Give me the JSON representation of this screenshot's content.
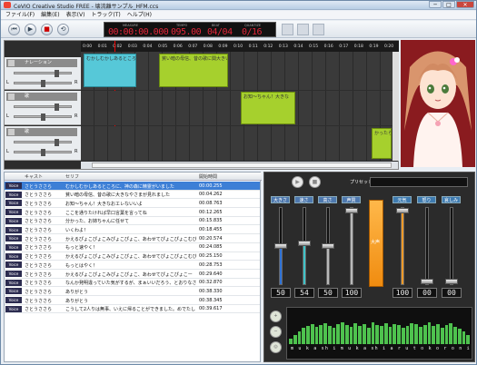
{
  "window": {
    "title": "CeVIO Creative Studio FREE - 壊流離サンプル_HFM.ccs",
    "minimize": "─",
    "maximize": "□",
    "close": "✕"
  },
  "menu": [
    "ファイル(F)",
    "編集(E)",
    "表示(V)",
    "トラック(T)",
    "ヘルプ(H)"
  ],
  "toolbar": {
    "rewind": "⏮",
    "play": "▶",
    "stop": "■",
    "loop": "⟲",
    "lcd": {
      "time_label": "MEASURE",
      "time": "00:00:00.000",
      "tempo_label": "TEMPO",
      "tempo": "095.00",
      "beat_label": "BEAT",
      "beat": "04/04",
      "quantize_label": "QUANTIZE",
      "quantize": "0/16"
    }
  },
  "ruler": [
    "0:00",
    "0:01",
    "0:02",
    "0:03",
    "0:04",
    "0:05",
    "0:06",
    "0:07",
    "0:08",
    "0:09",
    "0:10",
    "0:11",
    "0:12",
    "0:13",
    "0:14",
    "0:15",
    "0:16",
    "0:17",
    "0:18",
    "0:19",
    "0:20"
  ],
  "tracks": [
    {
      "name": "ナレーション",
      "pan_l": "L",
      "pan_r": "R"
    },
    {
      "name": "歌",
      "pan_l": "L",
      "pan_r": "R"
    },
    {
      "name": "歌",
      "pan_l": "L",
      "pan_r": "R"
    }
  ],
  "clips": [
    {
      "text": "むかしむかしあるところに",
      "color": "cyan"
    },
    {
      "text": "貧い暗の母信、昔の歌に関大きい",
      "color": "green"
    },
    {
      "text": "お知〜ちゃん！大きな",
      "color": "green"
    },
    {
      "text": "かったら",
      "color": "green"
    }
  ],
  "table": {
    "headers": {
      "cast": "キャスト",
      "line": "セリフ",
      "time": "開始時間"
    },
    "rows": [
      {
        "voice": "Voice",
        "cast": "さとうささら",
        "line": "むかしむかしあるところに、神の森に精霊がいました",
        "time": "00:00.255",
        "selected": true
      },
      {
        "voice": "Voice",
        "cast": "さとうささら",
        "line": "貧い暗の母信、昔の歌に大きなやさまが見れました",
        "time": "00:04.262",
        "selected": false
      },
      {
        "voice": "Voice",
        "cast": "さとうささら",
        "line": "お知〜ちゃん！大きなおエレないいよ",
        "time": "00:08.763",
        "selected": false
      },
      {
        "voice": "Voice",
        "cast": "さとうささら",
        "line": "ここを通りたければ早口言葉を言ってね",
        "time": "00:12.265",
        "selected": false
      },
      {
        "voice": "Voice",
        "cast": "さとうささら",
        "line": "分かった、お姉ちゃんに任せて",
        "time": "00:15.835",
        "selected": false
      },
      {
        "voice": "Voice",
        "cast": "さとうささら",
        "line": "いくわよ！",
        "time": "00:18.455",
        "selected": false
      },
      {
        "voice": "Voice",
        "cast": "さとうささら",
        "line": "かえるぴょこぴょこみぴょこぴょこ、あわせてぴょこぴょこむぴ",
        "time": "00:20.574",
        "selected": false
      },
      {
        "voice": "Voice",
        "cast": "さとうささら",
        "line": "もっと速やく！",
        "time": "00:24.085",
        "selected": false
      },
      {
        "voice": "Voice",
        "cast": "さとうささら",
        "line": "かえるぴょこぴょこみぴょこぴょこ、あわせてぴょこぴょこむぴ",
        "time": "00:25.150",
        "selected": false
      },
      {
        "voice": "Voice",
        "cast": "さとうささら",
        "line": "もっとはやく！",
        "time": "00:28.753",
        "selected": false
      },
      {
        "voice": "Voice",
        "cast": "さとうささら",
        "line": "かえるぴょこぴょこみぴょこぴょこ、あわせてぴょこぴょこー",
        "time": "00:29.640",
        "selected": false
      },
      {
        "voice": "Voice",
        "cast": "さとうささら",
        "line": "なんか発明違っていた気がするが、まぁいいだろう、とおりなさい",
        "time": "00:32.870",
        "selected": false
      },
      {
        "voice": "Voice",
        "cast": "さとうささら",
        "line": "ありがとう",
        "time": "00:38.330",
        "selected": false
      },
      {
        "voice": "Voice",
        "cast": "さとうささら",
        "line": "ありがとう",
        "time": "00:38.345",
        "selected": false
      },
      {
        "voice": "Voice",
        "cast": "さとうささら",
        "line": "こうして2人りは無事、いえに帰ることができました。めでたし",
        "time": "00:39.617",
        "selected": false
      }
    ]
  },
  "mixer": {
    "preset_label": "プリセット",
    "preset_value": "",
    "params": [
      {
        "label": "大きさ",
        "value": "50",
        "level": 0.5
      },
      {
        "label": "速さ",
        "value": "54",
        "level": 0.54
      },
      {
        "label": "高さ",
        "value": "50",
        "level": 0.5
      },
      {
        "label": "声質",
        "value": "100",
        "level": 1.0
      }
    ],
    "emotion_bar_label": "大声",
    "emotions": [
      {
        "label": "元気",
        "value": "100",
        "level": 1.0
      },
      {
        "label": "怒り",
        "value": "00",
        "level": 0.0
      },
      {
        "label": "哀しみ",
        "value": "00",
        "level": 0.0
      }
    ],
    "phonemes": "m u k a sh i m u k a sh i a r u t o k o r o n i",
    "colors": {
      "p1": "#2f73d8",
      "p2": "#3fc3c8",
      "p3": "#b9b9b9",
      "p4": "#b9b9b9",
      "e": "#f39a28"
    }
  }
}
